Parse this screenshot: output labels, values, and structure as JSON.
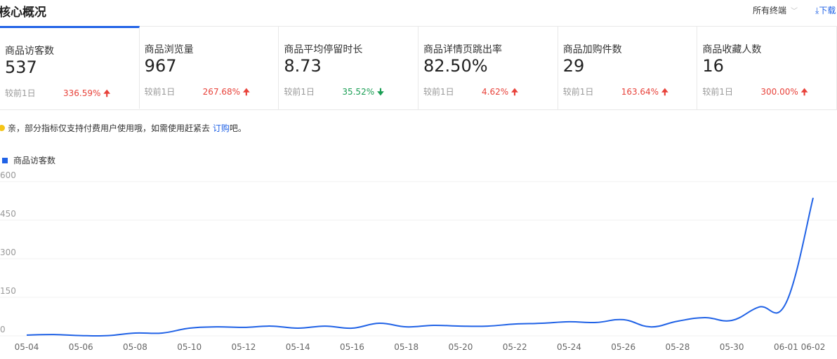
{
  "header": {
    "title": "核心概况",
    "terminal": "所有终端",
    "download": "下载"
  },
  "cards": [
    {
      "label": "商品访客数",
      "value": "537",
      "compare": "较前1日",
      "change": "336.59%",
      "dir": "up"
    },
    {
      "label": "商品浏览量",
      "value": "967",
      "compare": "较前1日",
      "change": "267.68%",
      "dir": "up"
    },
    {
      "label": "商品平均停留时长",
      "value": "8.73",
      "compare": "较前1日",
      "change": "35.52%",
      "dir": "down"
    },
    {
      "label": "商品详情页跳出率",
      "value": "82.50%",
      "compare": "较前1日",
      "change": "4.62%",
      "dir": "up"
    },
    {
      "label": "商品加购件数",
      "value": "29",
      "compare": "较前1日",
      "change": "163.64%",
      "dir": "up"
    },
    {
      "label": "商品收藏人数",
      "value": "16",
      "compare": "较前1日",
      "change": "300.00%",
      "dir": "up"
    }
  ],
  "notice": {
    "text": "亲，部分指标仅支持付费用户使用哦，如需使用赶紧去 ",
    "link": "订购",
    "suffix": "吧。"
  },
  "colors": {
    "accent": "#2062e6",
    "up": "#e8423a",
    "down": "#1a9e54"
  },
  "chart_data": {
    "type": "line",
    "legend": "商品访客数",
    "ylim": [
      0,
      600
    ],
    "yticks": [
      "0",
      "150",
      "300",
      "450",
      "600"
    ],
    "x": [
      "05-04",
      "05-05",
      "05-06",
      "05-07",
      "05-08",
      "05-09",
      "05-10",
      "05-11",
      "05-12",
      "05-13",
      "05-14",
      "05-15",
      "05-16",
      "05-17",
      "05-18",
      "05-19",
      "05-20",
      "05-21",
      "05-22",
      "05-23",
      "05-24",
      "05-25",
      "05-26",
      "05-27",
      "05-28",
      "05-29",
      "05-30",
      "05-31",
      "06-01",
      "06-02"
    ],
    "values": [
      3,
      5,
      1,
      1,
      11,
      11,
      30,
      35,
      33,
      38,
      30,
      38,
      30,
      49,
      35,
      41,
      38,
      38,
      46,
      49,
      55,
      52,
      63,
      35,
      57,
      71,
      60,
      112,
      128,
      537
    ]
  }
}
